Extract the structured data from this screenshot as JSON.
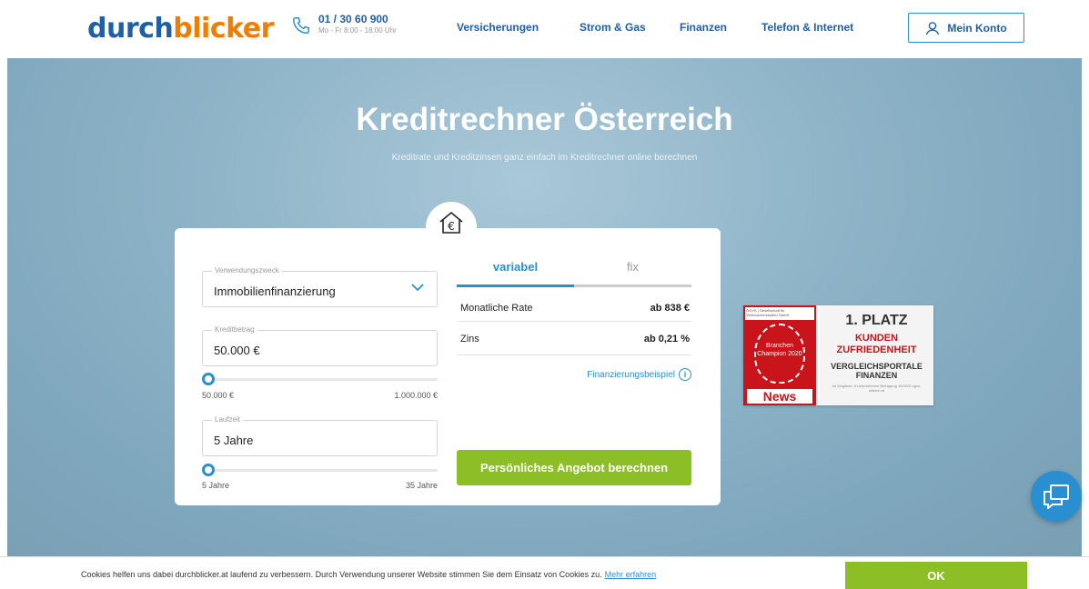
{
  "header": {
    "logo_part1": "durch",
    "logo_part2": "blicker",
    "phone_number": "01 / 30 60 900",
    "phone_hours": "Mo - Fr 8:00 - 18:00 Uhr",
    "nav": [
      "Versicherungen",
      "Strom & Gas",
      "Finanzen",
      "Telefon & Internet"
    ],
    "account_label": "Mein Konto"
  },
  "hero": {
    "title": "Kreditrechner Österreich",
    "subtitle": "Kreditrate und Kreditzinsen ganz einfach im Kreditrechner online berechnen"
  },
  "calculator": {
    "purpose": {
      "label": "Verwendungszweck",
      "value": "Immobilienfinanzierung"
    },
    "amount": {
      "label": "Kreditbetrag",
      "value": "50.000 €",
      "min": "50.000 €",
      "max": "1.000.000 €",
      "position": 0
    },
    "term": {
      "label": "Laufzeit",
      "value": "5 Jahre",
      "min": "5 Jahre",
      "max": "35 Jahre",
      "position": 0
    },
    "tabs": [
      "variabel",
      "fix"
    ],
    "active_tab": "variabel",
    "results": [
      {
        "label": "Monatliche Rate",
        "value": "ab 838 €"
      },
      {
        "label": "Zins",
        "value": "ab 0,21 %"
      }
    ],
    "example_link": "Finanzierungsbeispiel",
    "cta": "Persönliches Angebot berechnen"
  },
  "award": {
    "top_text": "ÖGVS | Gesellschaft für Verbraucherstudien GmbH",
    "circle_text": "Branchen Champion 2020",
    "brand": "News",
    "place": "1. PLATZ",
    "headline": "KUNDEN ZUFRIEDENHEIT",
    "category": "VERGLEICHSPORTALE FINANZEN",
    "footnote": "im Vergleich: 8 Unternehmen Befragung 10/2020 ogvs-kritisch.at"
  },
  "cookie": {
    "text": "Cookies helfen uns dabei durchblicker.at laufend zu verbessern. Durch Verwendung unserer Website stimmen Sie dem Einsatz von Cookies zu.",
    "link": "Mehr erfahren",
    "button": "OK"
  },
  "colors": {
    "brand_blue": "#1f5fa8",
    "brand_orange": "#f07c00",
    "accent": "#2a8fd0",
    "cta_green": "#8cbf26"
  }
}
